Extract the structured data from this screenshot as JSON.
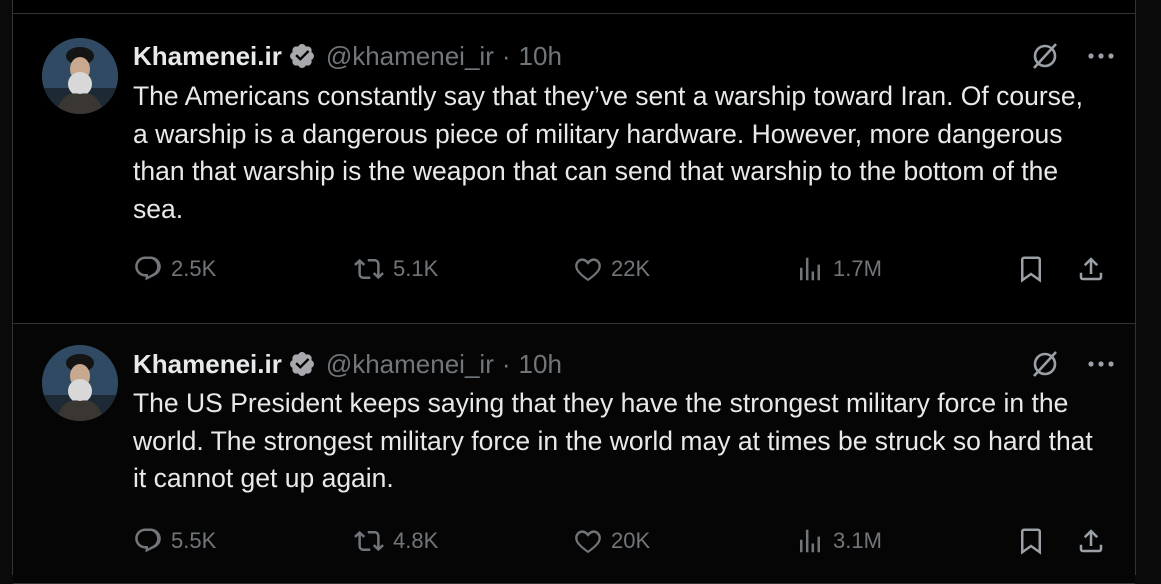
{
  "tweets": [
    {
      "author_name": "Khamenei.ir",
      "handle": "@khamenei_ir",
      "separator": "·",
      "time": "10h",
      "text": "The Americans constantly say that they’ve sent a warship toward Iran. Of course, a warship is a dangerous piece of military hardware. However, more dangerous than that warship is the weapon that can send that warship to the bottom of the sea.",
      "replies": "2.5K",
      "reposts": "5.1K",
      "likes": "22K",
      "views": "1.7M"
    },
    {
      "author_name": "Khamenei.ir",
      "handle": "@khamenei_ir",
      "separator": "·",
      "time": "10h",
      "text": "The US President keeps saying that they have the strongest military force in the world. The strongest military force in the world may at times be struck so hard that it cannot get up again.",
      "replies": "5.5K",
      "reposts": "4.8K",
      "likes": "20K",
      "views": "3.1M"
    }
  ],
  "icons": {
    "verified": "verified-badge-icon",
    "grok": "grok-icon",
    "more": "more-dots-icon",
    "reply": "reply-icon",
    "repost": "repost-icon",
    "like": "heart-icon",
    "views": "views-chart-icon",
    "bookmark": "bookmark-icon",
    "share": "share-icon"
  },
  "colors": {
    "background": "#000000",
    "text": "#e7e9ea",
    "muted": "#71767b",
    "border": "#2f3336"
  }
}
